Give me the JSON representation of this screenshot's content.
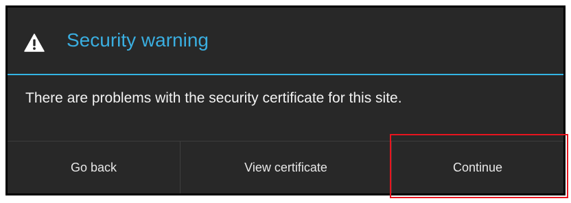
{
  "dialog": {
    "icon": "warning-triangle-icon",
    "title": "Security warning",
    "message": "There are problems with the security certificate for this site.",
    "accent_color": "#33b5e5",
    "buttons": {
      "go_back": "Go back",
      "view_certificate": "View certificate",
      "continue": "Continue"
    }
  },
  "highlight_color": "#e8141e"
}
